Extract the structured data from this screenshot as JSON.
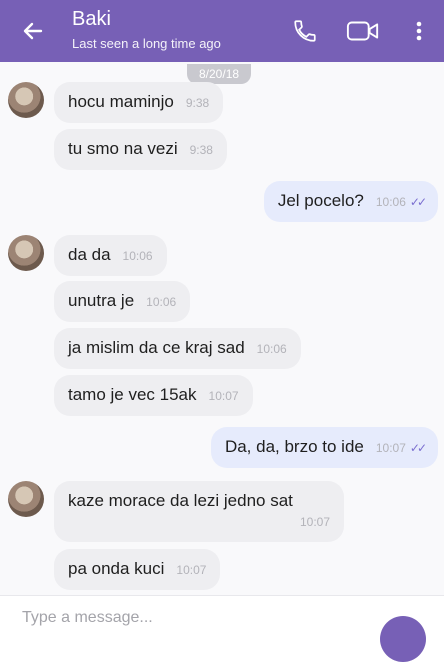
{
  "header": {
    "title": "Baki",
    "subtitle": "Last seen a long time ago",
    "icons": [
      "back-arrow-icon",
      "phone-icon",
      "video-icon",
      "more-vert-icon"
    ],
    "color": "#7760b6"
  },
  "chat": {
    "date": "8/20/18",
    "messages": [
      {
        "text": "hocu maminjo",
        "time": "9:38",
        "dir": "in"
      },
      {
        "text": "tu smo na vezi",
        "time": "9:38",
        "dir": "in"
      },
      {
        "text": "Jel pocelo?",
        "time": "10:06",
        "dir": "out"
      },
      {
        "text": "da da",
        "time": "10:06",
        "dir": "in"
      },
      {
        "text": "unutra je",
        "time": "10:06",
        "dir": "in"
      },
      {
        "text": "ja mislim da ce kraj sad",
        "time": "10:06",
        "dir": "in"
      },
      {
        "text": "tamo je vec 15ak",
        "time": "10:07",
        "dir": "in"
      },
      {
        "text": "Da, da, brzo to ide",
        "time": "10:07",
        "dir": "out"
      },
      {
        "text": "kaze morace da lezi jedno sat",
        "time": "10:07",
        "dir": "in"
      },
      {
        "text": "pa onda kuci",
        "time": "10:07",
        "dir": "in"
      }
    ]
  },
  "composer": {
    "placeholder": "Type a message..."
  }
}
